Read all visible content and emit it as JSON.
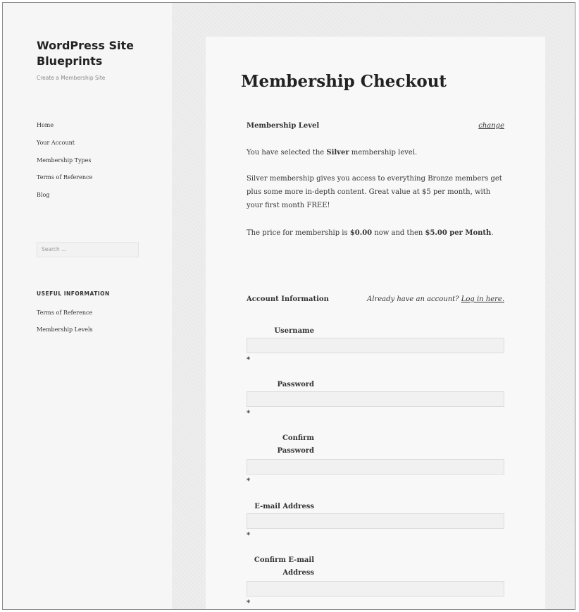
{
  "sidebar": {
    "site_title": "WordPress Site Blueprints",
    "site_description": "Create a Membership Site",
    "nav": [
      "Home",
      "Your Account",
      "Membership Types",
      "Terms of Reference",
      "Blog"
    ],
    "search_placeholder": "Search …",
    "widget_title": "USEFUL INFORMATION",
    "widget_links": [
      "Terms of Reference",
      "Membership Levels"
    ]
  },
  "main": {
    "page_title": "Membership Checkout",
    "membership_level": {
      "heading": "Membership Level",
      "change_link": "change",
      "selected_prefix": "You have selected the ",
      "selected_level": "Silver",
      "selected_suffix": " membership level.",
      "description": "Silver membership gives you access to everything Bronze members get plus some more in-depth content. Great value at $5 per month, with your first month FREE!",
      "price_prefix": "The price for membership is ",
      "price_now": "$0.00",
      "price_middle": " now and then ",
      "price_recurring": "$5.00 per Month",
      "price_end": "."
    },
    "account": {
      "heading": "Account Information",
      "login_prompt": "Already have an account?",
      "login_link": "Log in here.",
      "required_marker": "*",
      "fields": [
        {
          "label": "Username",
          "value": ""
        },
        {
          "label": "Password",
          "value": ""
        },
        {
          "label": "Confirm Password",
          "value": ""
        },
        {
          "label": "E-mail Address",
          "value": ""
        },
        {
          "label": "Confirm E-mail Address",
          "value": ""
        }
      ]
    }
  }
}
